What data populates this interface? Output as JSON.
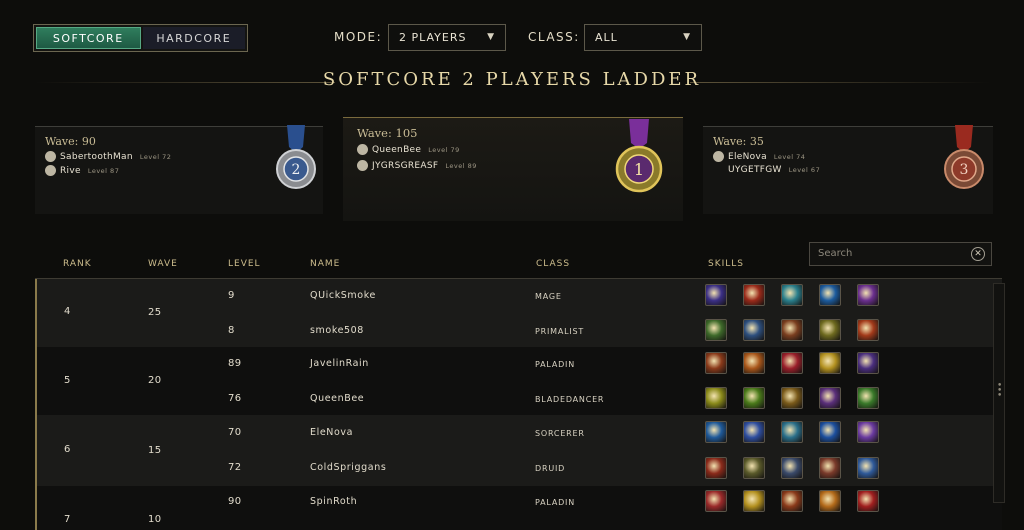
{
  "mode_toggle": {
    "softcore": "SOFTCORE",
    "hardcore": "HARDCORE"
  },
  "filters": {
    "mode_label": "MODE:",
    "mode_value": "2 PLAYERS",
    "class_label": "CLASS:",
    "class_value": "ALL"
  },
  "title": "SOFTCORE 2 PLAYERS LADDER",
  "podium": {
    "first": {
      "wave": "Wave: 105",
      "rank": "1",
      "players": [
        {
          "name": "QueenBee",
          "level": "Level 79"
        },
        {
          "name": "JYGRSGREASF",
          "level": "Level 89"
        }
      ]
    },
    "second": {
      "wave": "Wave: 90",
      "rank": "2",
      "players": [
        {
          "name": "SabertoothMan",
          "level": "Level 72"
        },
        {
          "name": "Rive",
          "level": "Level 87"
        }
      ]
    },
    "third": {
      "wave": "Wave: 35",
      "rank": "3",
      "players": [
        {
          "name": "EleNova",
          "level": "Level 74"
        },
        {
          "name": "UYGETFGW",
          "level": "Level 67"
        }
      ]
    }
  },
  "search": {
    "placeholder": "Search"
  },
  "table": {
    "headers": {
      "rank": "RANK",
      "wave": "WAVE",
      "level": "LEVEL",
      "name": "NAME",
      "class": "CLASS",
      "skills": "SKILLS"
    },
    "groups": [
      {
        "rank": "4",
        "wave": "25",
        "rows": [
          {
            "level": "9",
            "name": "QUickSmoke",
            "class": "MAGE"
          },
          {
            "level": "8",
            "name": "smoke508",
            "class": "PRIMALIST"
          }
        ]
      },
      {
        "rank": "5",
        "wave": "20",
        "rows": [
          {
            "level": "89",
            "name": "JavelinRain",
            "class": "PALADIN"
          },
          {
            "level": "76",
            "name": "QueenBee",
            "class": "BLADEDANCER"
          }
        ]
      },
      {
        "rank": "6",
        "wave": "15",
        "rows": [
          {
            "level": "70",
            "name": "EleNova",
            "class": "SORCERER"
          },
          {
            "level": "72",
            "name": "ColdSpriggans",
            "class": "DRUID"
          }
        ]
      },
      {
        "rank": "7",
        "wave": "10",
        "rows": [
          {
            "level": "90",
            "name": "SpinRoth",
            "class": "PALADIN"
          }
        ]
      }
    ]
  },
  "skill_icon_colors": {
    "g4r0": [
      "#3b2f86",
      "#9a2a1a",
      "#2a7f8c",
      "#1c5b9e",
      "#6a2f8e"
    ],
    "g4r1": [
      "#3e6a2a",
      "#2d4f7e",
      "#7a3e1f",
      "#6e6a1f",
      "#a23a1a"
    ],
    "g5r0": [
      "#8a3a1a",
      "#a8561a",
      "#9a1f2a",
      "#b39120",
      "#4a2e7e"
    ],
    "g5r1": [
      "#8a8a1a",
      "#4a7a1a",
      "#7a5a1a",
      "#5a2f7a",
      "#3a7a2a"
    ],
    "g6r0": [
      "#1f5a9a",
      "#2e4ea0",
      "#2a6f8a",
      "#1c4f9e",
      "#6a3aa0"
    ],
    "g6r1": [
      "#8a2a1a",
      "#5a5a2a",
      "#3a4a6a",
      "#7a3a2a",
      "#2f5a9a"
    ],
    "g7r0": [
      "#9a2a2a",
      "#b3901f",
      "#8a3a1a",
      "#b36a1a",
      "#a01f1f"
    ]
  }
}
